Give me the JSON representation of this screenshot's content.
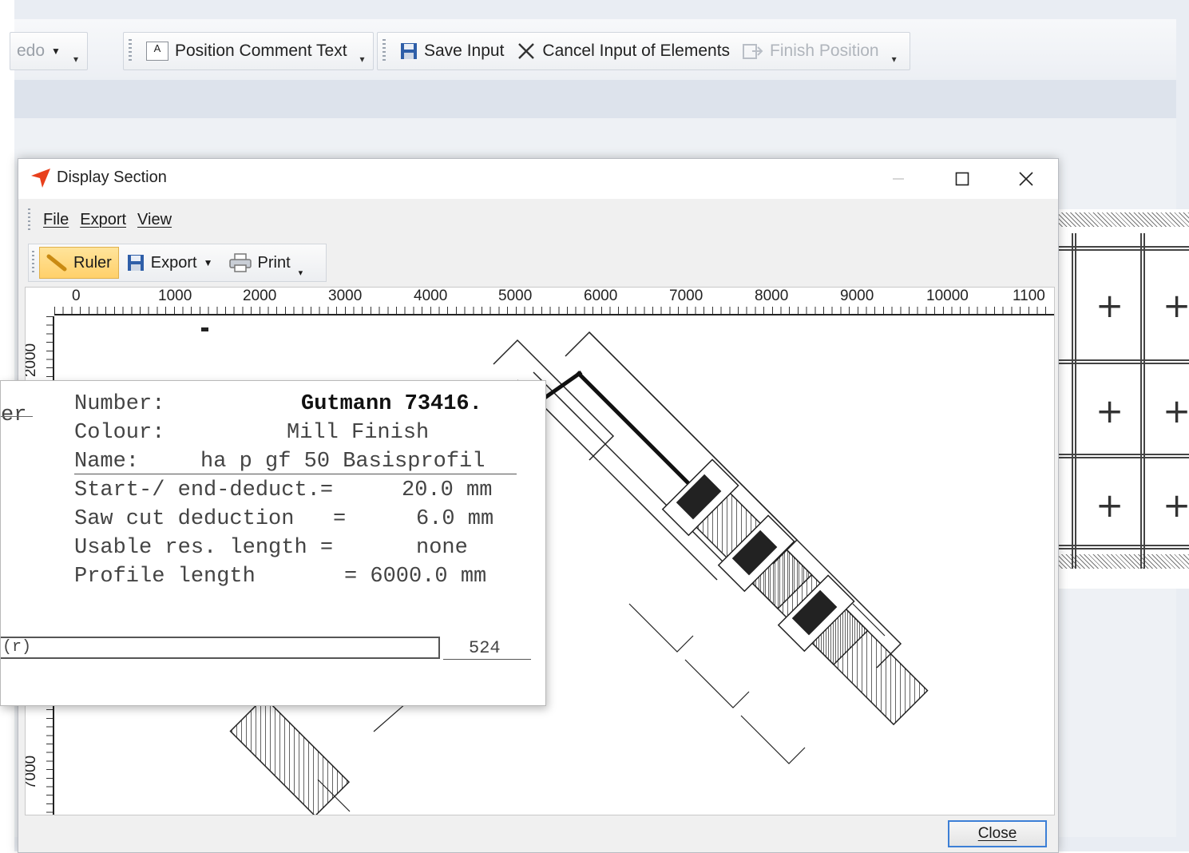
{
  "background_app": {
    "toolbar": {
      "redo_label": "edo",
      "position_comment_label": "Position Comment Text",
      "save_input_label": "Save Input",
      "cancel_input_label": "Cancel Input of Elements",
      "finish_position_label": "Finish Position"
    }
  },
  "dialog": {
    "title": "Display Section",
    "menu": [
      "File",
      "Export",
      "View"
    ],
    "toolbar": {
      "ruler_label": "Ruler",
      "export_label": "Export",
      "print_label": "Print"
    },
    "h_ruler_labels": [
      "0",
      "1000",
      "2000",
      "3000",
      "4000",
      "5000",
      "6000",
      "7000",
      "8000",
      "9000",
      "10000",
      "1100"
    ],
    "v_ruler_labels": [
      "2000",
      "7000"
    ],
    "close_label": "Close"
  },
  "callout": {
    "edge_text": "er",
    "number_label": "Number:",
    "number_value": "Gutmann 73416.",
    "colour_label": "Colour:",
    "colour_value": "Mill Finish",
    "name_label": "Name:",
    "name_value": "ha p gf 50 Basisprofil",
    "start_end_label": "Start-/ end-deduct.=",
    "start_end_value": "20.0 mm",
    "saw_cut_label": "Saw cut deduction   =",
    "saw_cut_value": "6.0 mm",
    "usable_label": "Usable res. length =",
    "usable_value": "none",
    "profile_label": "Profile length",
    "profile_value": "= 6000.0 mm",
    "bar_text": "(r)",
    "bar_number": "524"
  },
  "colors": {
    "ruler_active": "#ffd06a",
    "close_focus_border": "#3c7fd6",
    "app_icon": "#e8401c"
  }
}
